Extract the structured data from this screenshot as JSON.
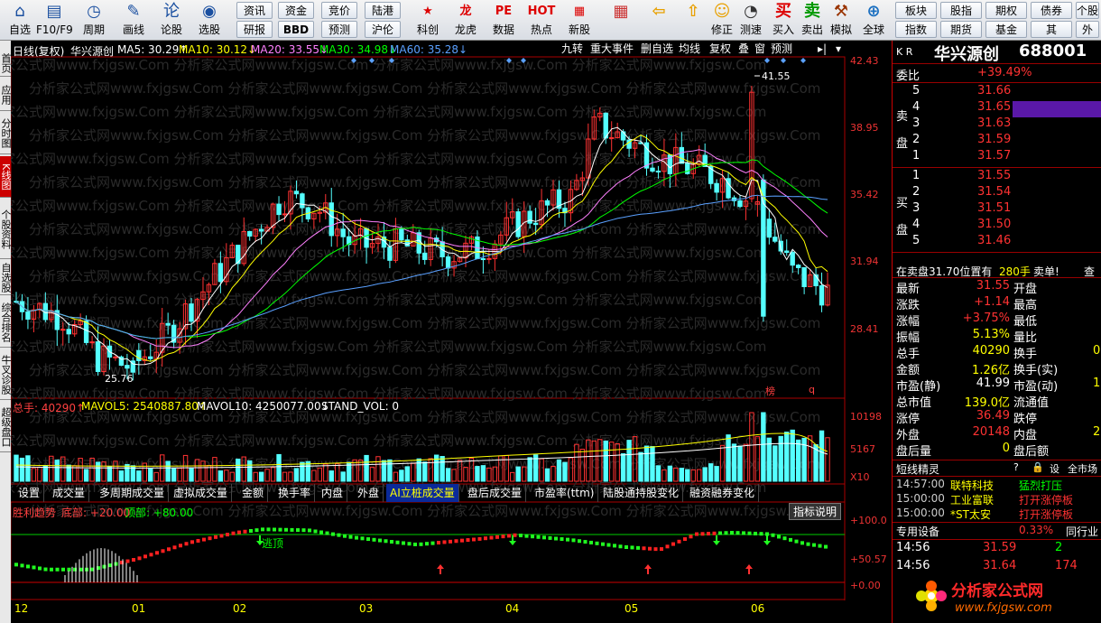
{
  "toolbar": {
    "big": [
      {
        "icon": "⌂",
        "label": "自选"
      },
      {
        "icon": "▤",
        "label": "F10/F9"
      },
      {
        "icon": "◷",
        "label": "周期"
      },
      {
        "icon": "✎",
        "label": "画线"
      },
      {
        "icon": "论",
        "label": "论股"
      },
      {
        "icon": "◉",
        "label": "选股"
      }
    ],
    "small": [
      "资讯",
      "资金",
      "竞价",
      "陆港",
      "研报",
      "BBD",
      "预测",
      "沪伦"
    ],
    "apps": [
      {
        "icon": "★",
        "label": "科创"
      },
      {
        "icon": "龙",
        "label": "龙虎"
      },
      {
        "icon": "PE",
        "label": "数据"
      },
      {
        "icon": "HOT",
        "label": "热点"
      },
      {
        "icon": "▦",
        "label": "新股"
      }
    ],
    "tools": [
      {
        "icon": "▦",
        "label": ""
      },
      {
        "icon": "⇦",
        "label": ""
      },
      {
        "icon": "⇧",
        "label": ""
      },
      {
        "icon": "☺",
        "label": "修正"
      },
      {
        "icon": "◔",
        "label": "测速"
      },
      {
        "icon": "买",
        "label": "买入"
      },
      {
        "icon": "卖",
        "label": "卖出"
      },
      {
        "icon": "⚒",
        "label": "模拟"
      },
      {
        "icon": "⊕",
        "label": "全球"
      }
    ],
    "right": [
      "板块",
      "股指",
      "期权",
      "债券",
      "个股",
      "指数",
      "期货",
      "基金",
      "其",
      "外"
    ]
  },
  "left_tabs": [
    "首页",
    "应用",
    "分时图",
    "K线图",
    "个股资料",
    "自选股",
    "综合排名",
    "牛叉诊股",
    "超级盘口"
  ],
  "chart_header": {
    "title": "日线(复权)",
    "name": "华兴源创",
    "ma5": "MA5: 30.29↑",
    "ma10": "MA10: 30.12↓",
    "ma20": "MA20: 33.55↓",
    "ma30": "MA30: 34.98↓",
    "ma60": "MA60: 35.28↓"
  },
  "top_tools": [
    "九转",
    "重大事件",
    "删自选",
    "均线",
    "复权",
    "叠",
    "窗",
    "预测"
  ],
  "price_axis": [
    "42.43",
    "38.95",
    "35.42",
    "31.94",
    "28.41"
  ],
  "annotations": {
    "high": "41.55",
    "low": "25.76",
    "bang": "榜",
    "q": "q"
  },
  "volume_header": {
    "total": "总手: 40290↑",
    "mavol5": "MAVOL5: 2540887.80↑",
    "mavol10": "MAVOL10: 4250077.00↓",
    "stand": "STAND_VOL: 0"
  },
  "volume_axis": [
    "10198",
    "5167",
    "X10"
  ],
  "bottom_tabs": [
    "设置",
    "成交量",
    "多周期成交量",
    "虚拟成交量",
    "金额",
    "换手率",
    "内盘",
    "外盘",
    "AI立桩成交量",
    "盘后成交量",
    "市盈率(ttm)",
    "陆股通持股变化",
    "融资融券变化"
  ],
  "indicator": {
    "title": "胜利趋势",
    "bottom": "底部: +20.00",
    "top": "顶部: +80.00",
    "help": "指标说明",
    "escape": "逃顶"
  },
  "indicator_axis": [
    "+100.0",
    "+50.57",
    "+0.00"
  ],
  "months": [
    "12",
    "01",
    "02",
    "03",
    "04",
    "05",
    "06"
  ],
  "watermark": "分析家公式网www.fxjgsw.Com",
  "right_panel": {
    "kr": "K R",
    "name": "华兴源创",
    "code": "688001",
    "weibi_label": "委比",
    "weibi": "+39.49%",
    "sell_label": "卖盘",
    "buy_label": "买盘",
    "sell": [
      {
        "n": "5",
        "p": "31.66"
      },
      {
        "n": "4",
        "p": "31.65"
      },
      {
        "n": "3",
        "p": "31.63"
      },
      {
        "n": "2",
        "p": "31.59"
      },
      {
        "n": "1",
        "p": "31.57"
      }
    ],
    "buy": [
      {
        "n": "1",
        "p": "31.55"
      },
      {
        "n": "2",
        "p": "31.54"
      },
      {
        "n": "3",
        "p": "31.51"
      },
      {
        "n": "4",
        "p": "31.50"
      },
      {
        "n": "5",
        "p": "31.46"
      }
    ],
    "bar_line": {
      "a": "在卖盘31.70位置有",
      "b": "280手",
      "c": "卖单!",
      "d": "查"
    },
    "stats": [
      {
        "l": "最新",
        "v": "31.55",
        "l2": "开盘",
        "c": "red"
      },
      {
        "l": "涨跌",
        "v": "+1.14",
        "l2": "最高",
        "c": "red"
      },
      {
        "l": "涨幅",
        "v": "+3.75%",
        "l2": "最低",
        "c": "red"
      },
      {
        "l": "振幅",
        "v": "5.13%",
        "l2": "量比",
        "c": "yel"
      },
      {
        "l": "总手",
        "v": "40290",
        "l2": "换手",
        "c": "yel"
      },
      {
        "l": "金额",
        "v": "1.26亿",
        "l2": "换手(实)",
        "c": "yel"
      },
      {
        "l": "市盈(静)",
        "v": "41.99",
        "l2": "市盈(动)",
        "c": "w"
      },
      {
        "l": "总市值",
        "v": "139.0亿",
        "l2": "流通值",
        "c": "yel"
      },
      {
        "l": "涨停",
        "v": "36.49",
        "l2": "跌停",
        "c": "red"
      },
      {
        "l": "外盘",
        "v": "20148",
        "l2": "内盘",
        "c": "red"
      },
      {
        "l": "盘后量",
        "v": "0",
        "l2": "盘后额",
        "c": "yel"
      }
    ],
    "stat_tail": [
      "",
      "",
      "",
      "",
      "0",
      "",
      "1",
      "",
      "",
      "2",
      ""
    ],
    "short_title": "短线精灵",
    "short_icons": [
      "?",
      "🔒",
      "设",
      "全市场"
    ],
    "short": [
      {
        "t": "14:57:00",
        "s": "联特科技",
        "e": "猛烈打压"
      },
      {
        "t": "15:00:00",
        "s": "工业富联",
        "e": "打开涨停板"
      },
      {
        "t": "15:00:00",
        "s": "*ST太安",
        "e": "打开涨停板"
      }
    ],
    "special_label": "专用设备",
    "special_val": "0.33%",
    "special_right": "同行业",
    "ticks": [
      {
        "t": "14:56",
        "p": "31.59",
        "v": "2"
      },
      {
        "t": "14:56",
        "p": "31.64",
        "v": "174"
      }
    ]
  },
  "colors": {
    "up": "#ff3232",
    "down": "#54ffff",
    "ma5": "#ffffff",
    "ma10": "#ffff00",
    "ma20": "#ff80ff",
    "ma30": "#00ff00",
    "ma60": "#5aa0ff"
  },
  "site_logo": "分析家公式网",
  "site_url": "www.fxjgsw.com"
}
